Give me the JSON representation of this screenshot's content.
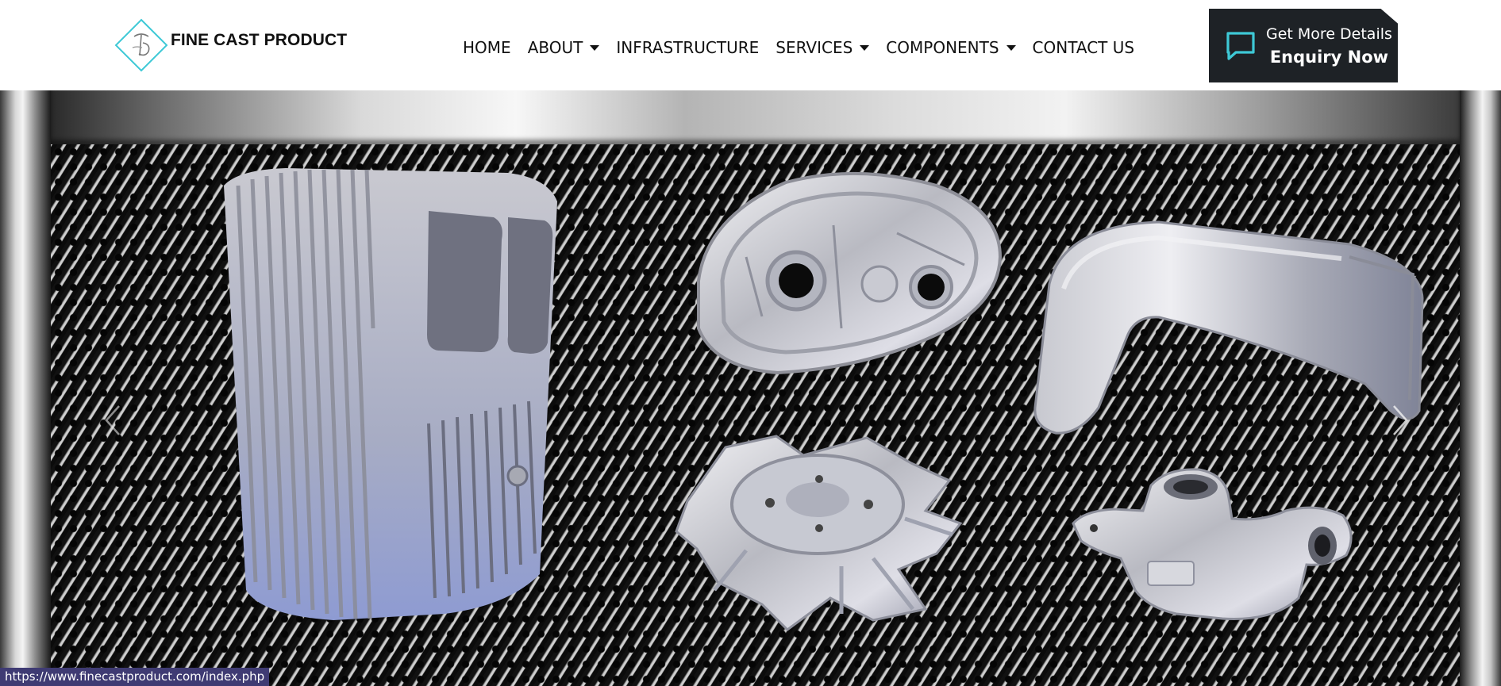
{
  "brand": {
    "name": "FINE CAST PRODUCT"
  },
  "nav": {
    "items": [
      {
        "label": "HOME",
        "has_dropdown": false
      },
      {
        "label": "ABOUT",
        "has_dropdown": true
      },
      {
        "label": "INFRASTRUCTURE",
        "has_dropdown": false
      },
      {
        "label": "SERVICES",
        "has_dropdown": true
      },
      {
        "label": "COMPONENTS",
        "has_dropdown": true
      },
      {
        "label": "CONTACT US",
        "has_dropdown": false
      }
    ]
  },
  "enquiry": {
    "line1": "Get More Details",
    "line2": "Enquiry Now",
    "icon": "chat-bubble-icon",
    "icon_color": "#3ec9d6",
    "background": "#1e2226"
  },
  "hero": {
    "slides_visible": 1,
    "controls": {
      "prev_icon": "chevron-left-icon",
      "next_icon": "chevron-right-icon"
    }
  },
  "status_bar": {
    "url": "https://www.finecastproduct.com/index.php"
  }
}
